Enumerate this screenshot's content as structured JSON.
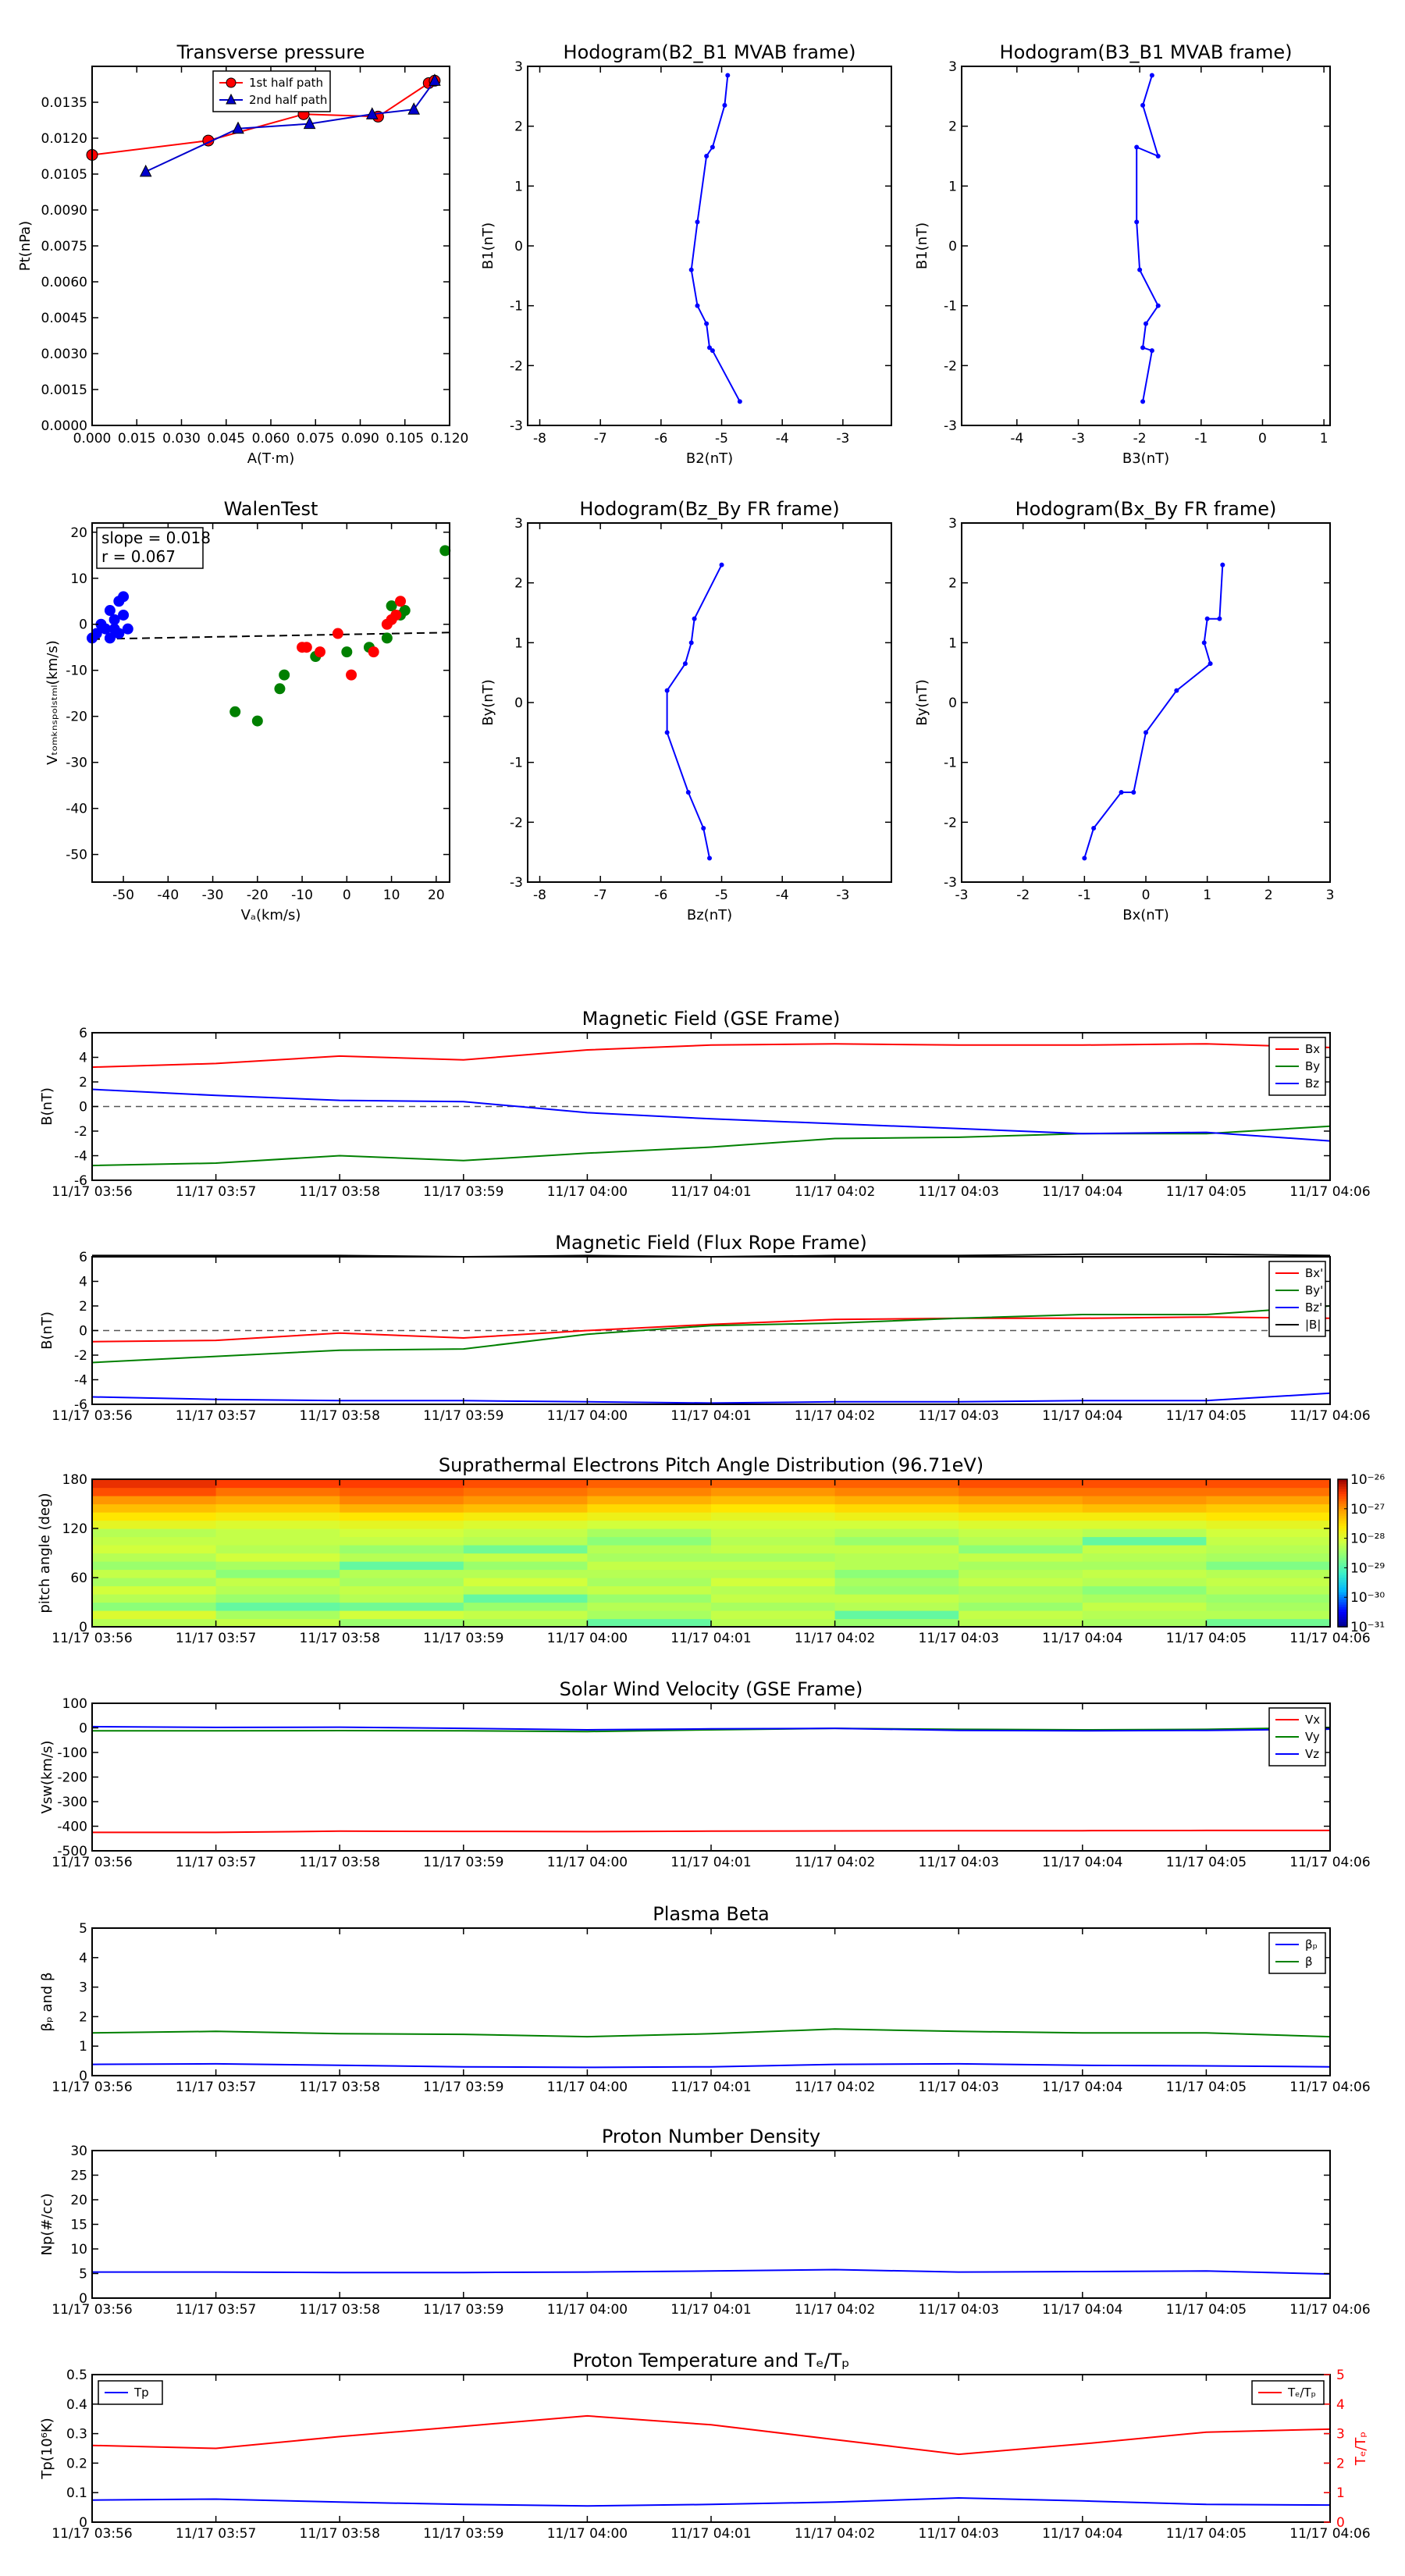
{
  "times": [
    "11/17 03:56",
    "11/17 03:57",
    "11/17 03:58",
    "11/17 03:59",
    "11/17 04:00",
    "11/17 04:01",
    "11/17 04:02",
    "11/17 04:03",
    "11/17 04:04",
    "11/17 04:05",
    "11/17 04:06"
  ],
  "chart_data": [
    {
      "id": "transverse_pressure",
      "type": "line",
      "title": "Transverse pressure",
      "xlabel": "A(T·m)",
      "ylabel": "Pt(nPa)",
      "xlim": [
        0.0,
        0.12
      ],
      "ylim": [
        0.0,
        0.015
      ],
      "xticks": [
        0.0,
        0.015,
        0.03,
        0.045,
        0.06,
        0.075,
        0.09,
        0.105,
        0.12
      ],
      "xticklabels": [
        "0.000",
        "0.015",
        "0.030",
        "0.045",
        "0.060",
        "0.075",
        "0.090",
        "0.105",
        "0.120"
      ],
      "yticks": [
        0.0,
        0.0015,
        0.003,
        0.0045,
        0.006,
        0.0075,
        0.009,
        0.0105,
        0.012,
        0.0135
      ],
      "yticklabels": [
        "0.0000",
        "0.0015",
        "0.0030",
        "0.0045",
        "0.0060",
        "0.0075",
        "0.0090",
        "0.0105",
        "0.0120",
        "0.0135"
      ],
      "legend": "top-center",
      "series": [
        {
          "name": "1st half path",
          "color": "#ff0000",
          "marker": "circle",
          "x": [
            0.0,
            0.039,
            0.071,
            0.096,
            0.113,
            0.115
          ],
          "y": [
            0.0113,
            0.0119,
            0.013,
            0.0129,
            0.0143,
            0.0144
          ]
        },
        {
          "name": "2nd half path",
          "color": "#0000cc",
          "marker": "triangle",
          "x": [
            0.115,
            0.108,
            0.094,
            0.073,
            0.049,
            0.018
          ],
          "y": [
            0.0144,
            0.0132,
            0.013,
            0.0126,
            0.0124,
            0.0106
          ]
        }
      ]
    },
    {
      "id": "hodo_b2_b1",
      "type": "line",
      "title": "Hodogram(B2_B1 MVAB frame)",
      "xlabel": "B2(nT)",
      "ylabel": "B1(nT)",
      "xlim": [
        -8.2,
        -2.2
      ],
      "ylim": [
        -3,
        3
      ],
      "xticks": [
        -8,
        -7,
        -6,
        -5,
        -4,
        -3
      ],
      "yticks": [
        -3,
        -2,
        -1,
        0,
        1,
        2,
        3
      ],
      "series": [
        {
          "color": "#0000ff",
          "x": [
            -4.9,
            -4.95,
            -5.15,
            -5.25,
            -5.4,
            -5.5,
            -5.4,
            -5.25,
            -5.2,
            -5.15,
            -4.7
          ],
          "y": [
            2.85,
            2.35,
            1.65,
            1.5,
            0.4,
            -0.4,
            -1.0,
            -1.3,
            -1.7,
            -1.75,
            -2.6
          ]
        }
      ]
    },
    {
      "id": "hodo_b3_b1",
      "type": "line",
      "title": "Hodogram(B3_B1 MVAB frame)",
      "xlabel": "B3(nT)",
      "ylabel": "B1(nT)",
      "xlim": [
        -4.9,
        1.1
      ],
      "ylim": [
        -3,
        3
      ],
      "xticks": [
        -4,
        -3,
        -2,
        -1,
        0,
        1
      ],
      "yticks": [
        -3,
        -2,
        -1,
        0,
        1,
        2,
        3
      ],
      "series": [
        {
          "color": "#0000ff",
          "x": [
            -1.8,
            -1.95,
            -1.7,
            -2.05,
            -2.05,
            -2.0,
            -1.7,
            -1.9,
            -1.95,
            -1.8,
            -1.95
          ],
          "y": [
            2.85,
            2.35,
            1.5,
            1.65,
            0.4,
            -0.4,
            -1.0,
            -1.3,
            -1.7,
            -1.75,
            -2.6
          ]
        }
      ]
    },
    {
      "id": "walen_test",
      "type": "scatter",
      "title": "WalenTest",
      "xlabel": "Vₐ(km/s)",
      "ylabel": "Vₜₒₘₖₙₛₚₒₗₛₜₘₗ(km/s)",
      "xlim": [
        -57,
        23
      ],
      "ylim": [
        -56,
        22
      ],
      "xticks": [
        -50,
        -40,
        -30,
        -20,
        -10,
        0,
        10,
        20
      ],
      "yticks": [
        -50,
        -40,
        -30,
        -20,
        -10,
        0,
        10,
        20
      ],
      "annotation": {
        "slope": "slope = 0.018",
        "r": "r = 0.067"
      },
      "fit_line": {
        "slope": 0.018,
        "intercept": -2.2
      },
      "series": [
        {
          "color": "#0000ff",
          "x": [
            -57,
            -56,
            -55,
            -54,
            -53,
            -52,
            -51,
            -50,
            -50,
            -49,
            -53,
            -52,
            -51
          ],
          "y": [
            -3,
            -2,
            0,
            -1,
            3,
            -1,
            5,
            6,
            2,
            -1,
            -3,
            1,
            -2
          ]
        },
        {
          "color": "#008000",
          "x": [
            -25,
            -20,
            -15,
            -14,
            -7,
            0,
            5,
            9,
            10,
            13,
            12,
            22
          ],
          "y": [
            -19,
            -21,
            -14,
            -11,
            -7,
            -6,
            -5,
            -3,
            4,
            3,
            2,
            16
          ]
        },
        {
          "color": "#ff0000",
          "x": [
            -10,
            -9,
            -6,
            -2,
            1,
            6,
            9,
            10,
            11,
            12
          ],
          "y": [
            -5,
            -5,
            -6,
            -2,
            -11,
            -6,
            0,
            1,
            2,
            5
          ]
        }
      ]
    },
    {
      "id": "hodo_bz_by",
      "type": "line",
      "title": "Hodogram(Bz_By FR frame)",
      "xlabel": "Bz(nT)",
      "ylabel": "By(nT)",
      "xlim": [
        -8.2,
        -2.2
      ],
      "ylim": [
        -3,
        3
      ],
      "xticks": [
        -8,
        -7,
        -6,
        -5,
        -4,
        -3
      ],
      "yticks": [
        -3,
        -2,
        -1,
        0,
        1,
        2,
        3
      ],
      "series": [
        {
          "color": "#0000ff",
          "x": [
            -5.0,
            -5.45,
            -5.5,
            -5.6,
            -5.9,
            -5.9,
            -5.55,
            -5.3,
            -5.2
          ],
          "y": [
            2.3,
            1.4,
            1.0,
            0.65,
            0.2,
            -0.5,
            -1.5,
            -2.1,
            -2.6
          ]
        }
      ]
    },
    {
      "id": "hodo_bx_by",
      "type": "line",
      "title": "Hodogram(Bx_By FR frame)",
      "xlabel": "Bx(nT)",
      "ylabel": "By(nT)",
      "xlim": [
        -3,
        3
      ],
      "ylim": [
        -3,
        3
      ],
      "xticks": [
        -3,
        -2,
        -1,
        0,
        1,
        2,
        3
      ],
      "yticks": [
        -3,
        -2,
        -1,
        0,
        1,
        2,
        3
      ],
      "series": [
        {
          "color": "#0000ff",
          "x": [
            1.25,
            1.2,
            1.0,
            0.95,
            1.05,
            0.5,
            0.0,
            -0.2,
            -0.4,
            -0.85,
            -1.0
          ],
          "y": [
            2.3,
            1.4,
            1.4,
            1.0,
            0.65,
            0.2,
            -0.5,
            -1.5,
            -1.5,
            -2.1,
            -2.6
          ]
        }
      ]
    },
    {
      "id": "mag_gse",
      "type": "line",
      "title": "Magnetic Field (GSE Frame)",
      "ylabel": "B(nT)",
      "ylim": [
        -6,
        6
      ],
      "yticks": [
        -6,
        -4,
        -2,
        0,
        2,
        4,
        6
      ],
      "legend": "top-right",
      "zero_line": true,
      "series": [
        {
          "name": "Bx",
          "color": "#ff0000",
          "values": [
            3.2,
            3.5,
            4.1,
            3.8,
            4.6,
            5.0,
            5.1,
            5.0,
            5.0,
            5.1,
            4.8
          ]
        },
        {
          "name": "By",
          "color": "#008000",
          "values": [
            -4.8,
            -4.6,
            -4.0,
            -4.4,
            -3.8,
            -3.3,
            -2.6,
            -2.5,
            -2.2,
            -2.2,
            -1.6
          ]
        },
        {
          "name": "Bz",
          "color": "#0000ff",
          "values": [
            1.4,
            0.9,
            0.5,
            0.4,
            -0.5,
            -1.0,
            -1.4,
            -1.8,
            -2.2,
            -2.1,
            -2.8
          ]
        }
      ]
    },
    {
      "id": "mag_fr",
      "type": "line",
      "title": "Magnetic Field (Flux Rope Frame)",
      "ylabel": "B(nT)",
      "ylim": [
        -6,
        6
      ],
      "yticks": [
        -6,
        -4,
        -2,
        0,
        2,
        4,
        6
      ],
      "legend": "top-right",
      "zero_line": true,
      "series": [
        {
          "name": "Bx'",
          "color": "#ff0000",
          "values": [
            -0.9,
            -0.8,
            -0.2,
            -0.6,
            0.0,
            0.5,
            0.9,
            1.0,
            1.0,
            1.1,
            1.0
          ]
        },
        {
          "name": "By'",
          "color": "#008000",
          "values": [
            -2.6,
            -2.1,
            -1.6,
            -1.5,
            -0.3,
            0.4,
            0.6,
            1.0,
            1.3,
            1.3,
            2.0
          ]
        },
        {
          "name": "Bz'",
          "color": "#0000ff",
          "values": [
            -5.4,
            -5.6,
            -5.7,
            -5.7,
            -5.8,
            -5.9,
            -5.8,
            -5.8,
            -5.7,
            -5.7,
            -5.1
          ]
        },
        {
          "name": "|B|",
          "color": "#000000",
          "values": [
            6.1,
            6.1,
            6.1,
            6.0,
            6.1,
            6.0,
            6.1,
            6.1,
            6.2,
            6.2,
            6.1
          ]
        }
      ]
    },
    {
      "id": "pad",
      "type": "heatmap",
      "title": "Suprathermal Electrons Pitch Angle Distribution (96.71eV)",
      "ylabel": "pitch angle (deg)",
      "ylim": [
        0,
        180
      ],
      "yticks": [
        0,
        60,
        120,
        180
      ],
      "colorbar_labels": [
        "10⁻²⁶",
        "10⁻²⁷",
        "10⁻²⁸",
        "10⁻²⁹",
        "10⁻³⁰",
        "10⁻³¹"
      ],
      "colorbar_levels": [
        -26,
        -27,
        -28,
        -29,
        -30,
        -31
      ],
      "levels": [
        [
          -28.3,
          -28.0,
          -28.6,
          -28.3,
          -28.1,
          -28.4,
          -28.2,
          -28.5,
          -28.3,
          -28.1,
          -28.2,
          -28.3,
          -27.9,
          -27.6,
          -27.3,
          -27.0,
          -26.6,
          -26.4
        ],
        [
          -28.2,
          -28.4,
          -28.9,
          -28.5,
          -28.3,
          -28.2,
          -28.6,
          -28.4,
          -28.1,
          -28.3,
          -28.2,
          -28.2,
          -28.0,
          -27.7,
          -27.4,
          -27.1,
          -26.8,
          -26.5
        ],
        [
          -28.5,
          -28.1,
          -28.8,
          -28.3,
          -28.2,
          -28.4,
          -28.3,
          -28.9,
          -28.3,
          -28.5,
          -28.2,
          -28.1,
          -27.9,
          -27.6,
          -27.2,
          -26.9,
          -26.7,
          -26.5
        ],
        [
          -28.4,
          -28.2,
          -28.5,
          -28.9,
          -28.3,
          -28.1,
          -28.3,
          -28.5,
          -28.2,
          -28.8,
          -28.3,
          -28.2,
          -28.0,
          -27.7,
          -27.3,
          -27.0,
          -26.8,
          -26.6
        ],
        [
          -28.9,
          -28.4,
          -28.3,
          -28.5,
          -28.2,
          -28.4,
          -28.3,
          -28.2,
          -28.4,
          -28.3,
          -28.6,
          -28.4,
          -28.1,
          -27.8,
          -27.5,
          -27.2,
          -26.9,
          -26.7
        ],
        [
          -28.3,
          -28.2,
          -28.4,
          -28.2,
          -28.3,
          -28.1,
          -28.3,
          -28.2,
          -28.4,
          -28.2,
          -28.3,
          -28.2,
          -28.1,
          -27.9,
          -27.6,
          -27.3,
          -27.0,
          -26.7
        ],
        [
          -28.5,
          -28.9,
          -28.3,
          -28.2,
          -28.5,
          -28.4,
          -28.6,
          -28.3,
          -28.3,
          -28.2,
          -28.5,
          -28.3,
          -28.1,
          -27.8,
          -27.5,
          -27.2,
          -26.9,
          -26.7
        ],
        [
          -28.3,
          -28.2,
          -28.5,
          -28.3,
          -28.4,
          -28.2,
          -28.3,
          -28.4,
          -28.2,
          -28.6,
          -28.3,
          -28.2,
          -28.0,
          -27.7,
          -27.4,
          -27.1,
          -26.8,
          -26.6
        ],
        [
          -28.4,
          -28.3,
          -28.2,
          -28.4,
          -28.6,
          -28.3,
          -28.2,
          -28.4,
          -28.3,
          -28.2,
          -28.9,
          -28.3,
          -28.0,
          -27.7,
          -27.3,
          -27.0,
          -26.8,
          -26.6
        ],
        [
          -28.8,
          -28.3,
          -28.4,
          -28.5,
          -28.3,
          -28.2,
          -28.3,
          -28.7,
          -28.4,
          -28.3,
          -28.2,
          -28.1,
          -27.9,
          -27.6,
          -27.4,
          -27.1,
          -26.8,
          -26.6
        ]
      ]
    },
    {
      "id": "sw_velocity",
      "type": "line",
      "title": "Solar Wind Velocity (GSE Frame)",
      "ylabel": "Vsw(km/s)",
      "ylim": [
        -500,
        100
      ],
      "yticks": [
        -500,
        -400,
        -300,
        -200,
        -100,
        0,
        100
      ],
      "legend": "top-right",
      "series": [
        {
          "name": "Vx",
          "color": "#ff0000",
          "values": [
            -425,
            -425,
            -420,
            -421,
            -422,
            -420,
            -419,
            -418,
            -418,
            -417,
            -417
          ]
        },
        {
          "name": "Vy",
          "color": "#008000",
          "values": [
            -12,
            -12,
            -11,
            -12,
            -15,
            -8,
            -2,
            -6,
            -8,
            -6,
            2
          ]
        },
        {
          "name": "Vz",
          "color": "#0000ff",
          "values": [
            5,
            2,
            3,
            -2,
            -8,
            -4,
            -2,
            -10,
            -12,
            -10,
            -5
          ]
        }
      ]
    },
    {
      "id": "plasma_beta",
      "type": "line",
      "title": "Plasma Beta",
      "ylabel": "βₚ and β",
      "ylim": [
        0,
        5
      ],
      "yticks": [
        0,
        1,
        2,
        3,
        4,
        5
      ],
      "legend": "top-right",
      "series": [
        {
          "name": "βₚ",
          "color": "#0000ff",
          "values": [
            0.38,
            0.4,
            0.35,
            0.3,
            0.28,
            0.3,
            0.38,
            0.4,
            0.35,
            0.33,
            0.3
          ]
        },
        {
          "name": "β",
          "color": "#008000",
          "values": [
            1.45,
            1.5,
            1.42,
            1.4,
            1.32,
            1.42,
            1.58,
            1.5,
            1.45,
            1.45,
            1.32
          ]
        }
      ]
    },
    {
      "id": "proton_density",
      "type": "line",
      "title": "Proton Number Density",
      "ylabel": "Np(#/cc)",
      "ylim": [
        0,
        30
      ],
      "yticks": [
        0,
        5,
        10,
        15,
        20,
        25,
        30
      ],
      "series": [
        {
          "color": "#0000ff",
          "values": [
            5.3,
            5.3,
            5.2,
            5.2,
            5.3,
            5.5,
            5.8,
            5.3,
            5.4,
            5.5,
            4.9
          ]
        }
      ]
    },
    {
      "id": "proton_temp",
      "type": "line",
      "title": "Proton Temperature and Tₑ/Tₚ",
      "ylabel": "Tp(10⁶K)",
      "ylim": [
        0,
        0.5
      ],
      "yticks": [
        0,
        0.1,
        0.2,
        0.3,
        0.4,
        0.5
      ],
      "y2label": "Tₑ/Tₚ",
      "y2lim": [
        0,
        5
      ],
      "y2ticks": [
        0,
        1,
        2,
        3,
        4,
        5
      ],
      "legend_left": "top-left",
      "legend_right": "top-right",
      "series": [
        {
          "name": "Tp",
          "color": "#0000ff",
          "axis": "left",
          "values": [
            0.075,
            0.078,
            0.068,
            0.06,
            0.055,
            0.06,
            0.068,
            0.082,
            0.072,
            0.06,
            0.058
          ]
        },
        {
          "name": "Tₑ/Tₚ",
          "color": "#ff0000",
          "axis": "right",
          "values": [
            2.6,
            2.5,
            2.9,
            3.25,
            3.6,
            3.3,
            2.8,
            2.3,
            2.65,
            3.05,
            3.15
          ]
        }
      ]
    }
  ]
}
